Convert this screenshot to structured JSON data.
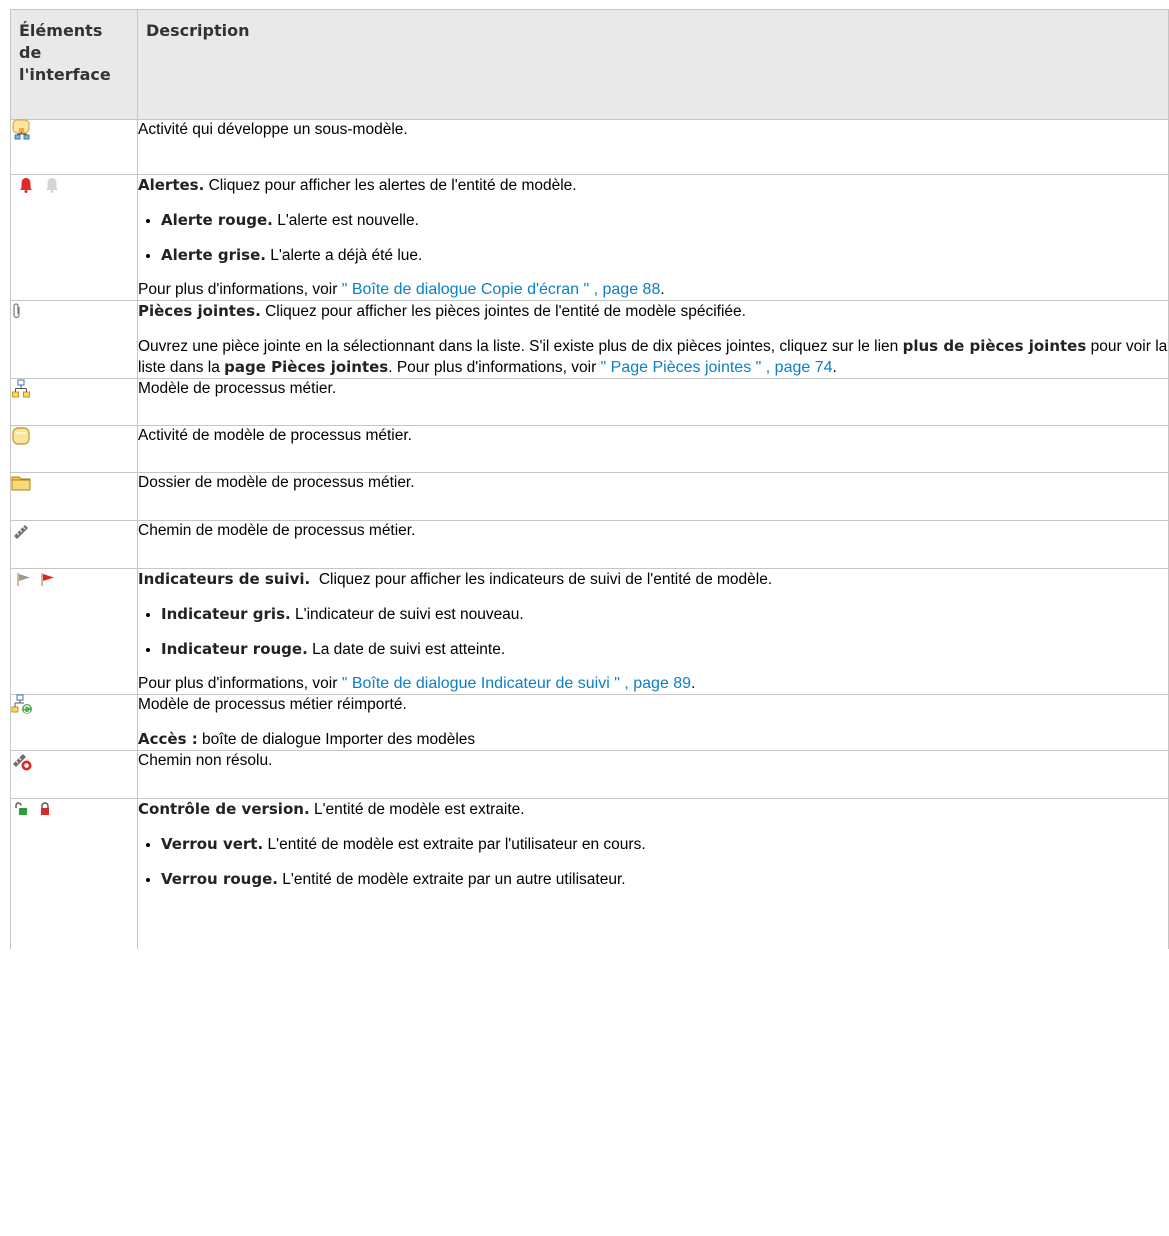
{
  "table": {
    "header": {
      "col1": "Éléments de l'interface",
      "col2": "Description"
    },
    "rows": [
      {
        "icons": [
          "submodel-activity-icon"
        ],
        "text": "Activité qui développe un sous-modèle."
      },
      {
        "icons": [
          "alert-red-icon",
          "alert-gray-icon"
        ],
        "title": "Alertes.",
        "text": "Cliquez pour afficher les alertes de l'entité de modèle.",
        "bullets": [
          {
            "title": "Alerte rouge.",
            "text": "L'alerte est nouvelle."
          },
          {
            "title": "Alerte grise.",
            "text": "L'alerte a déjà été lue."
          }
        ],
        "more_prefix": "Pour plus d'informations, voir",
        "more_link": "\" Boîte de dialogue Copie d'écran \" , page 88",
        "more_suffix": "."
      },
      {
        "icons": [
          "paperclip-icon"
        ],
        "title": "Pièces jointes.",
        "text": "Cliquez pour afficher les pièces jointes de l'entité de modèle spécifiée.",
        "p2_a": "Ouvrez une pièce jointe en la sélectionnant dans la liste. S'il existe plus de dix pièces jointes, cliquez sur le lien",
        "p2_b": "plus de pièces jointes",
        "p2_c": "pour voir la liste dans la",
        "p2_d": "page Pièces jointes",
        "p2_e": ". Pour plus d'informations, voir",
        "p2_link": "\" Page Pièces jointes \" , page 74",
        "p2_end": "."
      },
      {
        "icons": [
          "business-process-model-icon"
        ],
        "text": "Modèle de processus métier."
      },
      {
        "icons": [
          "activity-icon"
        ],
        "text": "Activité de modèle de processus métier."
      },
      {
        "icons": [
          "folder-icon"
        ],
        "text": "Dossier de modèle de processus métier."
      },
      {
        "icons": [
          "path-icon"
        ],
        "text": "Chemin de modèle de processus métier."
      },
      {
        "icons": [
          "flag-gray-icon",
          "flag-red-icon"
        ],
        "title": "Indicateurs de suivi.",
        "text": "Cliquez pour afficher les indicateurs de suivi de l'entité de modèle.",
        "bullets": [
          {
            "title": "Indicateur gris.",
            "text": "L'indicateur de suivi est nouveau."
          },
          {
            "title": "Indicateur rouge.",
            "text": "La date de suivi est atteinte."
          }
        ],
        "more_prefix": "Pour plus d'informations, voir",
        "more_link": "\" Boîte de dialogue Indicateur de suivi \" , page 89",
        "more_suffix": "."
      },
      {
        "icons": [
          "reimported-model-icon"
        ],
        "text": "Modèle de processus métier réimporté.",
        "access_label": "Accès :",
        "access_text": "boîte de dialogue Importer des modèles"
      },
      {
        "icons": [
          "unresolved-path-icon"
        ],
        "text": "Chemin non résolu."
      },
      {
        "icons": [
          "lock-green-icon",
          "lock-red-icon"
        ],
        "title": "Contrôle de version.",
        "text": "L'entité de modèle est extraite.",
        "bullets": [
          {
            "title": "Verrou vert.",
            "text": "L'entité de modèle est extraite par l'utilisateur en cours."
          },
          {
            "title": "Verrou rouge.",
            "text": "L'entité de modèle extraite par un autre utilisateur."
          }
        ]
      }
    ]
  }
}
